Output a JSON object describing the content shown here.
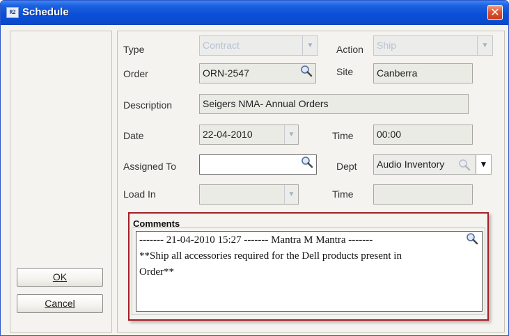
{
  "window": {
    "title": "Schedule",
    "app_icon": "app-icon",
    "close_glyph": "✕",
    "close_icon": "close-icon"
  },
  "buttons": {
    "ok_label": "OK",
    "cancel_label": "Cancel"
  },
  "form": {
    "type": {
      "label": "Type",
      "value": "Contract"
    },
    "action": {
      "label": "Action",
      "value": "Ship"
    },
    "order": {
      "label": "Order",
      "value": "ORN-2547"
    },
    "site": {
      "label": "Site",
      "value": "Canberra"
    },
    "description": {
      "label": "Description",
      "value": "Seigers NMA- Annual Orders"
    },
    "date": {
      "label": "Date",
      "value": "22-04-2010"
    },
    "time": {
      "label": "Time",
      "value": "00:00"
    },
    "assigned_to": {
      "label": "Assigned To",
      "value": ""
    },
    "dept": {
      "label": "Dept",
      "value": "Audio Inventory"
    },
    "load_in": {
      "label": "Load In",
      "value": ""
    },
    "time2": {
      "label": "Time",
      "value": ""
    }
  },
  "comments": {
    "label": "Comments",
    "lines": [
      "------- 21-04-2010 15:27 ------- Mantra M Mantra -------",
      "**Ship all accessories required for the Dell products present in",
      "Order**"
    ]
  },
  "icons": {
    "search": "magnifier-icon",
    "dropdown": "chevron-down-icon"
  },
  "colors": {
    "titlebar": "#0a4fd7",
    "highlight_border": "#a31f25",
    "close": "#e0552f"
  }
}
